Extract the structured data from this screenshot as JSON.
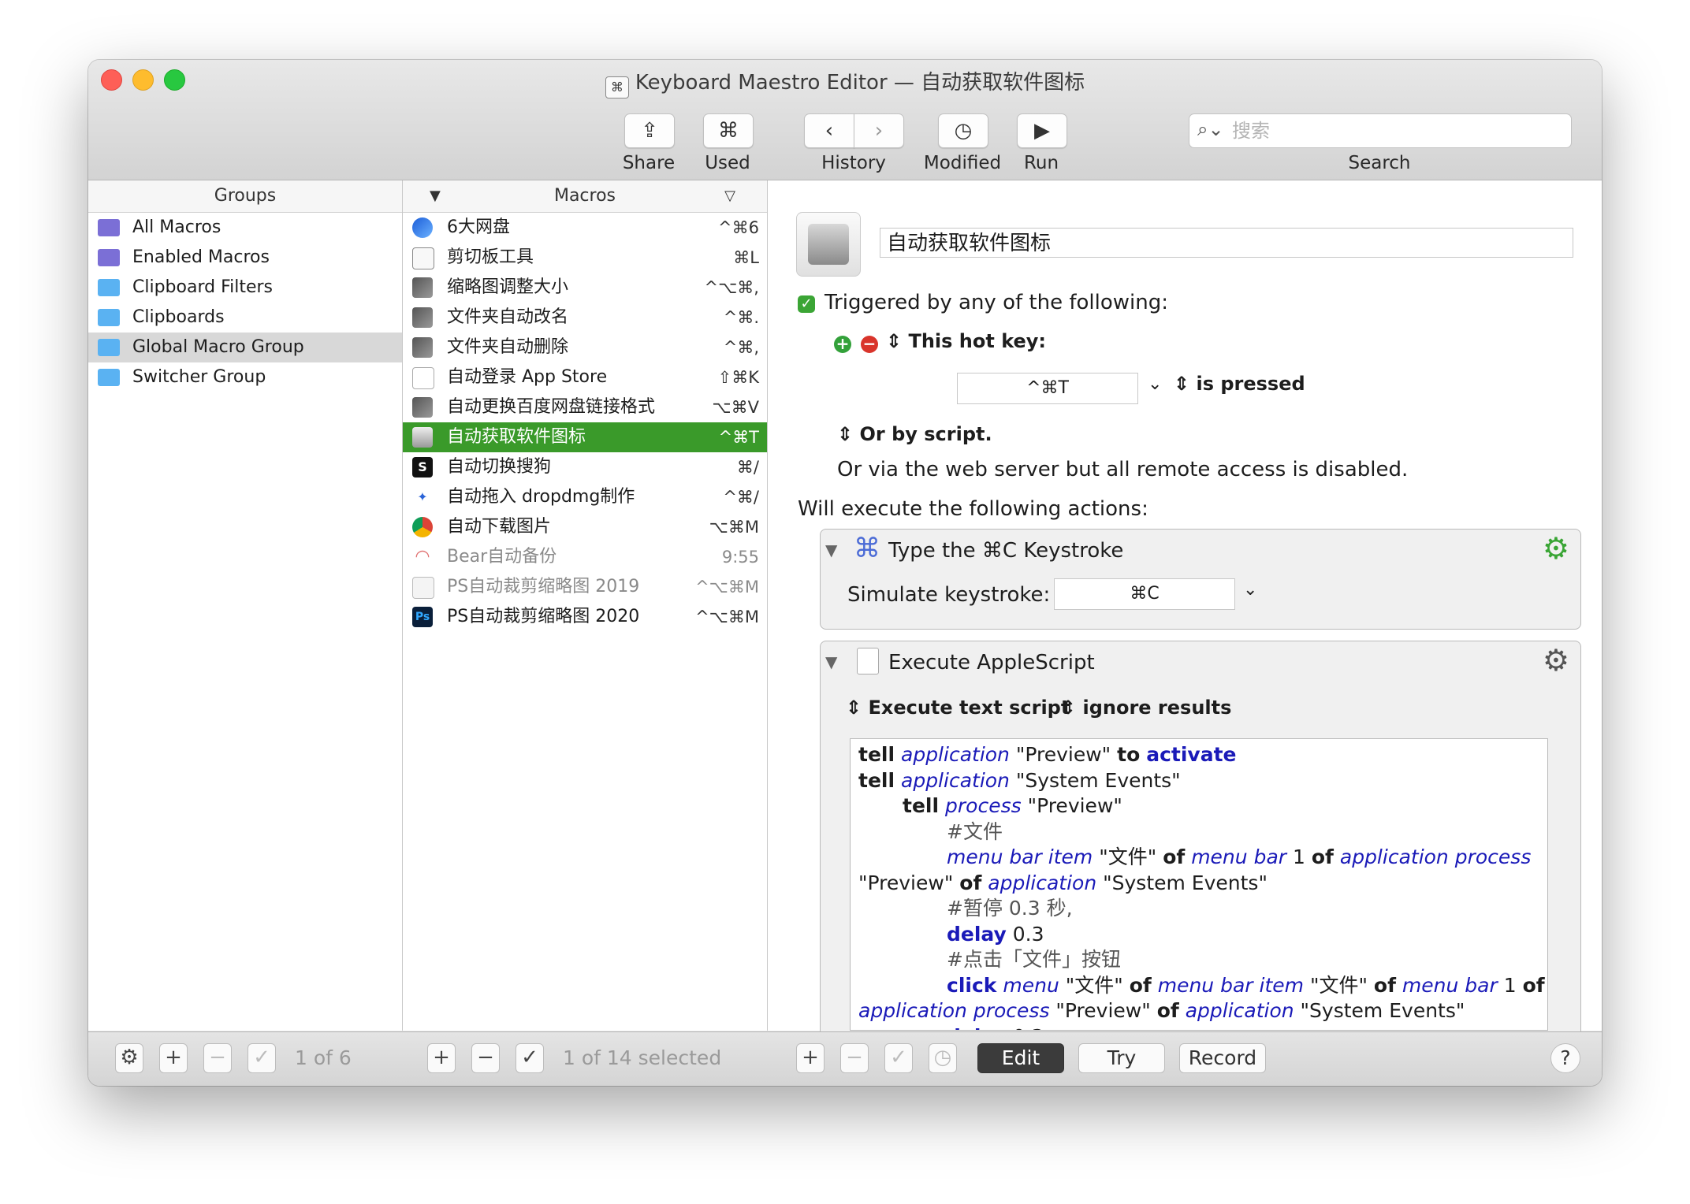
{
  "window": {
    "title": "Keyboard Maestro Editor — 自动获取软件图标"
  },
  "toolbar": {
    "share_label": "Share",
    "used_label": "Used",
    "history_label": "History",
    "modified_label": "Modified",
    "run_label": "Run",
    "search_label": "Search",
    "search_placeholder": "搜索"
  },
  "groups": {
    "header": "Groups",
    "items": [
      {
        "label": "All Macros"
      },
      {
        "label": "Enabled Macros"
      },
      {
        "label": "Clipboard Filters"
      },
      {
        "label": "Clipboards"
      },
      {
        "label": "Global Macro Group"
      },
      {
        "label": "Switcher Group"
      }
    ],
    "count": "1 of 6"
  },
  "macros": {
    "header": "Macros",
    "items": [
      {
        "label": "6大网盘",
        "key": "^⌘6"
      },
      {
        "label": "剪切板工具",
        "key": "⌘L"
      },
      {
        "label": "缩略图调整大小",
        "key": "^⌥⌘,"
      },
      {
        "label": "文件夹自动改名",
        "key": "^⌘."
      },
      {
        "label": "文件夹自动删除",
        "key": "^⌘,"
      },
      {
        "label": "自动登录 App Store",
        "key": "⇧⌘K"
      },
      {
        "label": "自动更换百度网盘链接格式",
        "key": "⌥⌘V"
      },
      {
        "label": "自动获取软件图标",
        "key": "^⌘T"
      },
      {
        "label": "自动切换搜狗",
        "key": "⌘/"
      },
      {
        "label": "自动拖入 dropdmg制作",
        "key": "^⌘/"
      },
      {
        "label": "自动下载图片",
        "key": "⌥⌘M"
      },
      {
        "label": "Bear自动备份",
        "key": "9:55"
      },
      {
        "label": "PS自动裁剪缩略图 2019",
        "key": "^⌥⌘M"
      },
      {
        "label": "PS自动裁剪缩略图 2020",
        "key": "^⌥⌘M"
      }
    ],
    "count": "1 of 14 selected"
  },
  "detail": {
    "macro_name": "自动获取软件图标",
    "triggered_label": "Triggered by any of the following:",
    "hotkey_label": "This hot key:",
    "hotkey_value": "^⌘T",
    "is_pressed": "is pressed",
    "or_by_script": "Or by script.",
    "web_server_note": "Or via the web server but all remote access is disabled.",
    "will_execute": "Will execute the following actions:",
    "action1": {
      "title": "Type the ⌘C Keystroke",
      "simulate_label": "Simulate keystroke:",
      "keystroke": "⌘C"
    },
    "action2": {
      "title": "Execute AppleScript",
      "execute_mode": "Execute text script",
      "results_mode": "ignore results"
    }
  },
  "bottom": {
    "edit": "Edit",
    "try": "Try",
    "record": "Record",
    "help": "?"
  }
}
